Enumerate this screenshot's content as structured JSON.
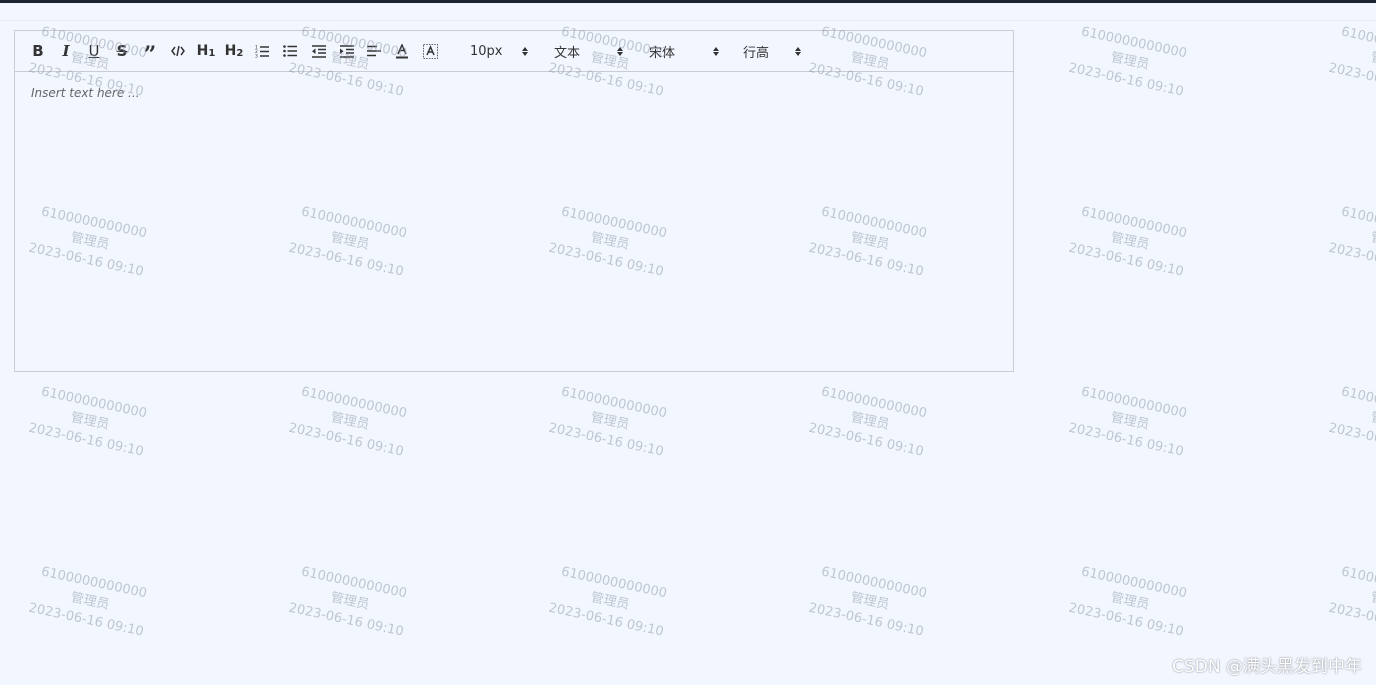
{
  "toolbar": {
    "font_size": "10px",
    "text_type": "文本",
    "font_family": "宋体",
    "line_height": "行高",
    "icons": [
      "bold-icon",
      "italic-icon",
      "underline-icon",
      "strikethrough-icon",
      "blockquote-icon",
      "code-icon",
      "heading-1-icon",
      "heading-2-icon",
      "ordered-list-icon",
      "bullet-list-icon",
      "outdent-icon",
      "indent-icon",
      "align-icon",
      "font-color-icon",
      "background-color-icon"
    ]
  },
  "editor": {
    "placeholder": "Insert text here ..."
  },
  "watermark": {
    "line1": "6100000000000",
    "line2": "管理员",
    "line3": "2023-06-16 09:10"
  },
  "footer": {
    "credit": "CSDN @满头黑发到中年"
  }
}
